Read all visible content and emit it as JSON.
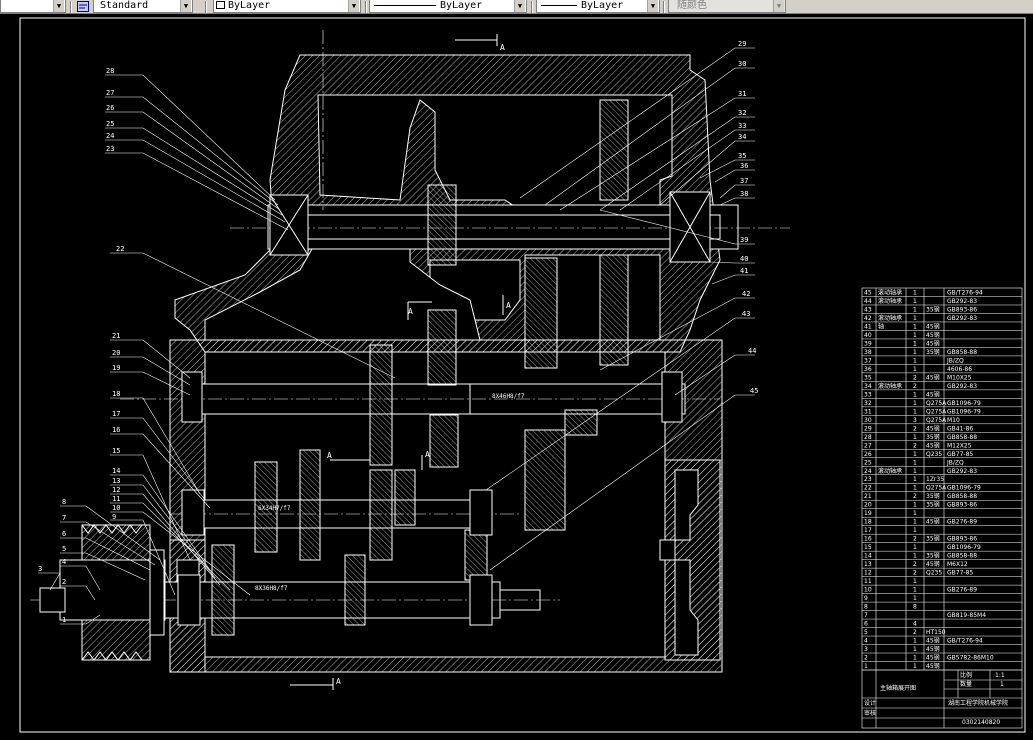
{
  "toolbar": {
    "text_style_value": "Standard",
    "layer_value": "ByLayer",
    "linetype_value": "ByLayer",
    "lineweight_value": "ByLayer",
    "plotstyle_value": "随颜色",
    "colors": {
      "bg": "#d4d0c8",
      "canvas": "#000000",
      "ink": "#ffffff"
    }
  },
  "drawing": {
    "section_labels": [
      "A",
      "A",
      "A",
      "A",
      "A",
      "A"
    ],
    "leaders_left": [
      "28",
      "27",
      "26",
      "25",
      "24",
      "23",
      "22",
      "21",
      "20",
      "19",
      "18",
      "17",
      "16",
      "15",
      "14",
      "13",
      "12",
      "11",
      "10",
      "9",
      "8",
      "7",
      "6",
      "5",
      "4",
      "3",
      "2",
      "1"
    ],
    "leaders_right": [
      "29",
      "30",
      "31",
      "32",
      "33",
      "34",
      "35",
      "36",
      "37",
      "38",
      "39",
      "40",
      "41",
      "42",
      "43",
      "44",
      "45"
    ],
    "shaft_notes": [
      "8X46H8/f7",
      "6X34H7/f7",
      "8X36H8/f7",
      "8X46H8/f7"
    ]
  },
  "bom": {
    "rows": [
      {
        "no": "45",
        "name": "滚动轴承",
        "qty": "1",
        "mat": "",
        "std": "GB/T276-94"
      },
      {
        "no": "44",
        "name": "滚动轴承",
        "qty": "1",
        "mat": "",
        "std": "GB292-83"
      },
      {
        "no": "43",
        "name": "",
        "qty": "1",
        "mat": "35钢",
        "std": "GB893-86"
      },
      {
        "no": "42",
        "name": "滚动轴承",
        "qty": "1",
        "mat": "",
        "std": "GB292-83"
      },
      {
        "no": "41",
        "name": "轴",
        "qty": "1",
        "mat": "45钢",
        "std": ""
      },
      {
        "no": "40",
        "name": "",
        "qty": "1",
        "mat": "45钢",
        "std": ""
      },
      {
        "no": "39",
        "name": "",
        "qty": "1",
        "mat": "45钢",
        "std": ""
      },
      {
        "no": "38",
        "name": "",
        "qty": "1",
        "mat": "35钢",
        "std": "GB858-88"
      },
      {
        "no": "37",
        "name": "",
        "qty": "1",
        "mat": "",
        "std": "JB/ZQ"
      },
      {
        "no": "36",
        "name": "",
        "qty": "1",
        "mat": "",
        "std": "4606-86"
      },
      {
        "no": "35",
        "name": "",
        "qty": "2",
        "mat": "45钢",
        "std": "M10X25"
      },
      {
        "no": "34",
        "name": "滚动轴承",
        "qty": "2",
        "mat": "",
        "std": "GB292-83"
      },
      {
        "no": "33",
        "name": "",
        "qty": "1",
        "mat": "45钢",
        "std": ""
      },
      {
        "no": "32",
        "name": "",
        "qty": "1",
        "mat": "Q275A",
        "std": "GB1096-79"
      },
      {
        "no": "31",
        "name": "",
        "qty": "1",
        "mat": "Q275A",
        "std": "GB1096-79"
      },
      {
        "no": "30",
        "name": "",
        "qty": "3",
        "mat": "Q275A",
        "std": "M10"
      },
      {
        "no": "29",
        "name": "",
        "qty": "2",
        "mat": "45钢",
        "std": "GB41-86"
      },
      {
        "no": "28",
        "name": "",
        "qty": "1",
        "mat": "35钢",
        "std": "GB858-88"
      },
      {
        "no": "27",
        "name": "",
        "qty": "2",
        "mat": "45钢",
        "std": "M12X25"
      },
      {
        "no": "26",
        "name": "",
        "qty": "1",
        "mat": "Q235",
        "std": "GB77-85"
      },
      {
        "no": "25",
        "name": "",
        "qty": "1",
        "mat": "",
        "std": "JB/ZQ"
      },
      {
        "no": "24",
        "name": "滚动轴承",
        "qty": "1",
        "mat": "",
        "std": "GB292-83"
      },
      {
        "no": "23",
        "name": "",
        "qty": "1",
        "mat": "1Zr35",
        "std": ""
      },
      {
        "no": "22",
        "name": "",
        "qty": "1",
        "mat": "Q275A",
        "std": "GB1096-79"
      },
      {
        "no": "21",
        "name": "",
        "qty": "2",
        "mat": "35钢",
        "std": "GB858-88"
      },
      {
        "no": "20",
        "name": "",
        "qty": "1",
        "mat": "35钢",
        "std": "GB893-86"
      },
      {
        "no": "19",
        "name": "",
        "qty": "1",
        "mat": "",
        "std": ""
      },
      {
        "no": "18",
        "name": "",
        "qty": "1",
        "mat": "45钢",
        "std": "GB276-89"
      },
      {
        "no": "17",
        "name": "",
        "qty": "1",
        "mat": "",
        "std": ""
      },
      {
        "no": "16",
        "name": "",
        "qty": "2",
        "mat": "35钢",
        "std": "GB893-86"
      },
      {
        "no": "15",
        "name": "",
        "qty": "1",
        "mat": "",
        "std": "GB1096-79"
      },
      {
        "no": "14",
        "name": "",
        "qty": "1",
        "mat": "35钢",
        "std": "GB858-88"
      },
      {
        "no": "13",
        "name": "",
        "qty": "2",
        "mat": "45钢",
        "std": "M6X12"
      },
      {
        "no": "12",
        "name": "",
        "qty": "2",
        "mat": "Q235",
        "std": "GB77-85"
      },
      {
        "no": "11",
        "name": "",
        "qty": "1",
        "mat": "",
        "std": ""
      },
      {
        "no": "10",
        "name": "",
        "qty": "1",
        "mat": "",
        "std": "GB276-89"
      },
      {
        "no": "9",
        "name": "",
        "qty": "1",
        "mat": "",
        "std": ""
      },
      {
        "no": "8",
        "name": "",
        "qty": "8",
        "mat": "",
        "std": ""
      },
      {
        "no": "7",
        "name": "",
        "qty": "",
        "mat": "",
        "std": "GB819-85M4"
      },
      {
        "no": "6",
        "name": "",
        "qty": "4",
        "mat": "",
        "std": ""
      },
      {
        "no": "5",
        "name": "",
        "qty": "2",
        "mat": "HT150",
        "std": ""
      },
      {
        "no": "4",
        "name": "",
        "qty": "1",
        "mat": "45钢",
        "std": "GB/T276-94"
      },
      {
        "no": "3",
        "name": "",
        "qty": "1",
        "mat": "45钢",
        "std": ""
      },
      {
        "no": "2",
        "name": "",
        "qty": "1",
        "mat": "45钢",
        "std": "GB5782-86M10"
      },
      {
        "no": "1",
        "name": "",
        "qty": "1",
        "mat": "45钢",
        "std": ""
      }
    ],
    "title_block": {
      "drawing_title": "主轴箱展开图",
      "scale_label": "比例",
      "scale_value": "1:1",
      "sheet_label": "数量",
      "sheet_value": "1",
      "designer_label": "设计",
      "checker_label": "审核",
      "school": "湖南工程学院机械学院",
      "student_id": "0302140820"
    }
  }
}
